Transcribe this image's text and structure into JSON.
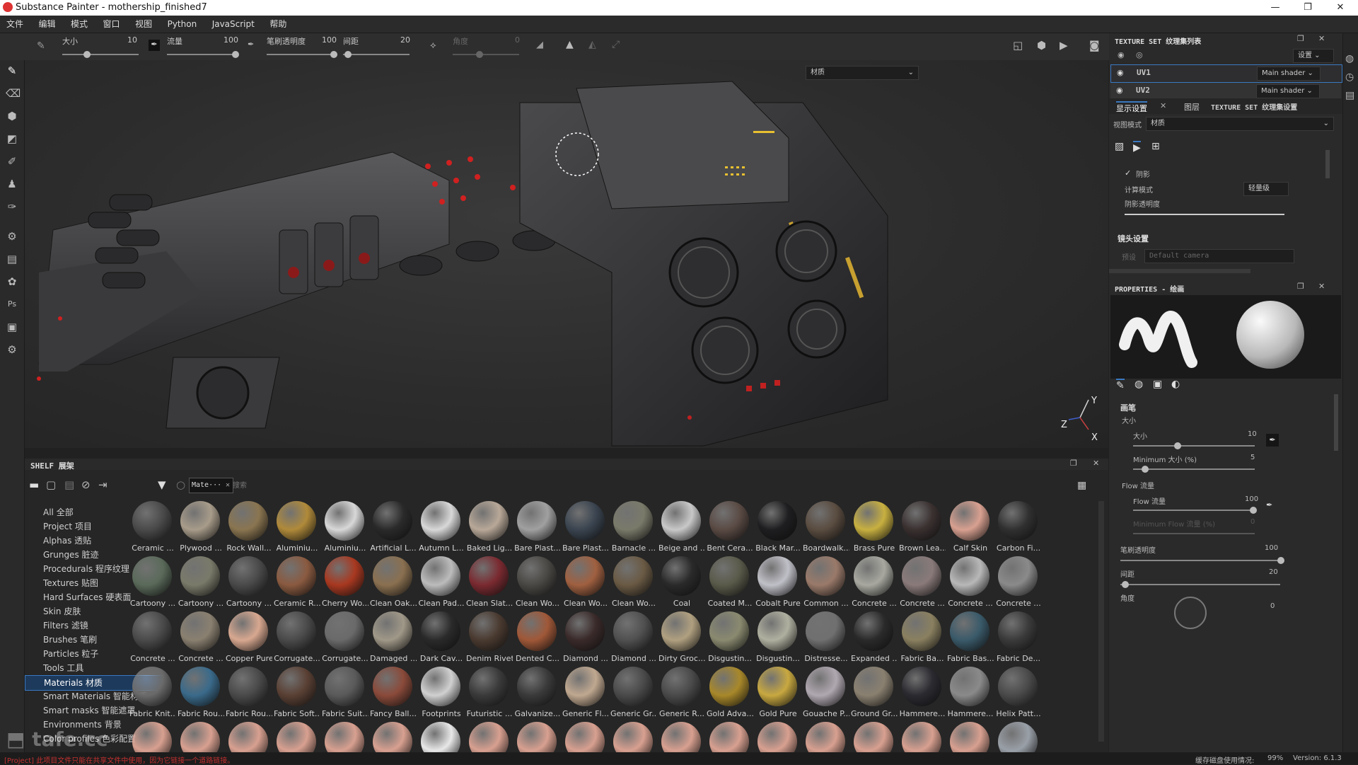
{
  "window": {
    "title": "Substance Painter - mothership_finished7",
    "min": "—",
    "max": "❐",
    "close": "✕"
  },
  "menu": [
    "文件",
    "编辑",
    "模式",
    "窗口",
    "视图",
    "Python",
    "JavaScript",
    "帮助"
  ],
  "toolbar": {
    "size_label": "大小",
    "size_value": "10",
    "flow_label": "流量",
    "flow_value": "100",
    "opacity_label": "笔刷透明度",
    "opacity_value": "100",
    "spacing_label": "间距",
    "spacing_value": "20",
    "angle_label": "角度",
    "angle_value": "0"
  },
  "viewport": {
    "mode_dropdown": "材质",
    "axis_y": "Y",
    "axis_z": "Z",
    "axis_x": "X"
  },
  "shelf": {
    "title": "SHELF 展架",
    "filter_tag": "Mate···",
    "search_placeholder": "搜索",
    "categories": [
      "All 全部",
      "Project 项目",
      "Alphas 透贴",
      "Grunges 脏迹",
      "Procedurals 程序纹理",
      "Textures 贴图",
      "Hard Surfaces 硬表面",
      "Skin 皮肤",
      "Filters 滤镜",
      "Brushes 笔刷",
      "Particles 粒子",
      "Tools 工具",
      "Materials 材质",
      "Smart Materials 智能材质",
      "Smart masks 智能遮罩",
      "Environments 背景",
      "Color profiles 色彩配置"
    ],
    "selected_category": "Materials 材质",
    "materials_row1": [
      "Ceramic ...",
      "Plywood ...",
      "Rock Wall...",
      "Aluminiu...",
      "Aluminiu...",
      "Artificial L...",
      "Autumn L...",
      "Baked Lig...",
      "Bare Plast...",
      "Bare Plast...",
      "Barnacle ...",
      "Beige and ...",
      "Bent Cera...",
      "Black Mar...",
      "Boardwalk...",
      "Brass Pure",
      "Brown Lea...",
      "Calf Skin",
      "Carbon Fi..."
    ],
    "materials_row2": [
      "Cartoony ...",
      "Cartoony ...",
      "Cartoony ...",
      "Ceramic R...",
      "Cherry Wo...",
      "Clean Oak...",
      "Clean Pad...",
      "Clean Slat...",
      "Clean Wo...",
      "Clean Wo...",
      "Clean Wo...",
      "Coal",
      "Coated M...",
      "Cobalt Pure",
      "Common ...",
      "Concrete ...",
      "Concrete ...",
      "Concrete ...",
      "Concrete ..."
    ],
    "materials_row3": [
      "Concrete ...",
      "Concrete ...",
      "Copper Pure",
      "Corrugate...",
      "Corrugate...",
      "Damaged ...",
      "Dark Cav...",
      "Denim Rivet",
      "Dented C...",
      "Diamond ...",
      "Diamond ...",
      "Dirty Groc...",
      "Disgustin...",
      "Disgustin...",
      "Distresse...",
      "Expanded ...",
      "Fabric Ba...",
      "Fabric Bas...",
      "Fabric De..."
    ],
    "materials_row4": [
      "Fabric Knit...",
      "Fabric Rou...",
      "Fabric Rou...",
      "Fabric Soft...",
      "Fabric Suit...",
      "Fancy Ball...",
      "Footprints",
      "Futuristic ...",
      "Galvanize...",
      "Generic Fl...",
      "Generic Gr...",
      "Generic R...",
      "Gold Adva...",
      "Gold Pure",
      "Gouache P...",
      "Ground Gr...",
      "Hammere...",
      "Hammere...",
      "Helix Patt..."
    ],
    "ball_colors_row1": [
      "#4a4a4a",
      "#a89c8a",
      "#8a7550",
      "#b08a3a",
      "#d8d8d8",
      "#2a2a2a",
      "#d8d8d8",
      "#b8a898",
      "#a0a0a0",
      "#3a4450",
      "#7a7a6a",
      "#c8c8c8",
      "#5a4a44",
      "#1e1e20",
      "#5a4c40",
      "#c8b040",
      "#3a3030",
      "#d8a090",
      "#303030"
    ],
    "ball_colors_row2": [
      "#5a6a5a",
      "#7a7a6a",
      "#4a4a4a",
      "#8a5a40",
      "#a83820",
      "#8a7050",
      "#bcbcbc",
      "#7a2a30",
      "#4a4844",
      "#a06040",
      "#6a5a44",
      "#2a2a2a",
      "#5a5a4a",
      "#c0c0c8",
      "#9a7a6a",
      "#a8a8a0",
      "#8a7a7a",
      "#b8b8b8",
      "#8a8a8a"
    ],
    "ball_colors_row3": [
      "#4a4a4a",
      "#8a8070",
      "#d8a890",
      "#4a4a4a",
      "#6a6a6a",
      "#a09888",
      "#2a2a2a",
      "#4a3a30",
      "#a05838",
      "#3a2a2a",
      "#505050",
      "#b0a080",
      "#8a8a70",
      "#b0b0a0",
      "#707070",
      "#2a2a2a",
      "#8a8060",
      "#3a5a6a",
      "#3a3a3a"
    ],
    "ball_colors_row4": [
      "#6a6a6a",
      "#3a6a8a",
      "#4a4a4a",
      "#5a4034",
      "#5a5a5a",
      "#8a4a3a",
      "#d0d0d0",
      "#3a3a3a",
      "#3a3a3a",
      "#c0a890",
      "#4a4a4a",
      "#4a4a4a",
      "#a8882a",
      "#c8a840",
      "#b0a8b0",
      "#8a8070",
      "#2a2a30",
      "#8a8a8a",
      "#4a4a4a"
    ],
    "ball_colors_row5": [
      "#d8a090",
      "#d8a090",
      "#d8a090",
      "#d8a090",
      "#d8a090",
      "#d8a090",
      "#e8e8e8",
      "#d8a090",
      "#d8a090",
      "#d8a090",
      "#d8a090",
      "#d8a090",
      "#d8a090",
      "#d8a090",
      "#d8a090",
      "#d8a090",
      "#d8a090",
      "#d8a090",
      "#9aa0a8"
    ]
  },
  "texture_set_list": {
    "title": "TEXTURE SET 纹理集列表",
    "settings_label": "设置",
    "rows": [
      {
        "name": "UV1",
        "shader": "Main shader"
      },
      {
        "name": "UV2",
        "shader": "Main shader"
      }
    ]
  },
  "display_settings": {
    "tabs": [
      "显示设置",
      "图层",
      "TEXTURE SET 纹理集设置"
    ],
    "view_mode_label": "视图模式",
    "view_mode_value": "材质",
    "shadow_label": "阴影",
    "compute_label": "计算模式",
    "compute_value": "轻量级",
    "shadow_opacity_label": "阴影透明度",
    "camera_section": "镜头设置",
    "preset_label": "预设",
    "preset_value": "Default camera"
  },
  "properties": {
    "title": "PROPERTIES - 绘画",
    "brush_section": "画笔",
    "size_group": "大小",
    "size_label": "大小",
    "size_value": "10",
    "min_size_label": "Minimum 大小 (%)",
    "min_size_value": "5",
    "flow_group": "Flow 流量",
    "flow_label": "Flow 流量",
    "flow_value": "100",
    "min_flow_label": "Minimum Flow 流量 (%)",
    "min_flow_value": "0",
    "opacity_label": "笔刷透明度",
    "opacity_value": "100",
    "spacing_label": "间距",
    "spacing_value": "20",
    "angle_label": "角度",
    "angle_value": "0"
  },
  "status": {
    "error_text": "[Project] 此项目文件只能在共享文件中使用，因为它链接一个道路链接。",
    "disk_label": "缓存磁盘使用情况:",
    "disk_value": "99%",
    "version": "Version: 6.1.3"
  },
  "colors": {
    "accent": "#3a78c0",
    "error": "#c43030",
    "panel": "#2a2a2a"
  }
}
